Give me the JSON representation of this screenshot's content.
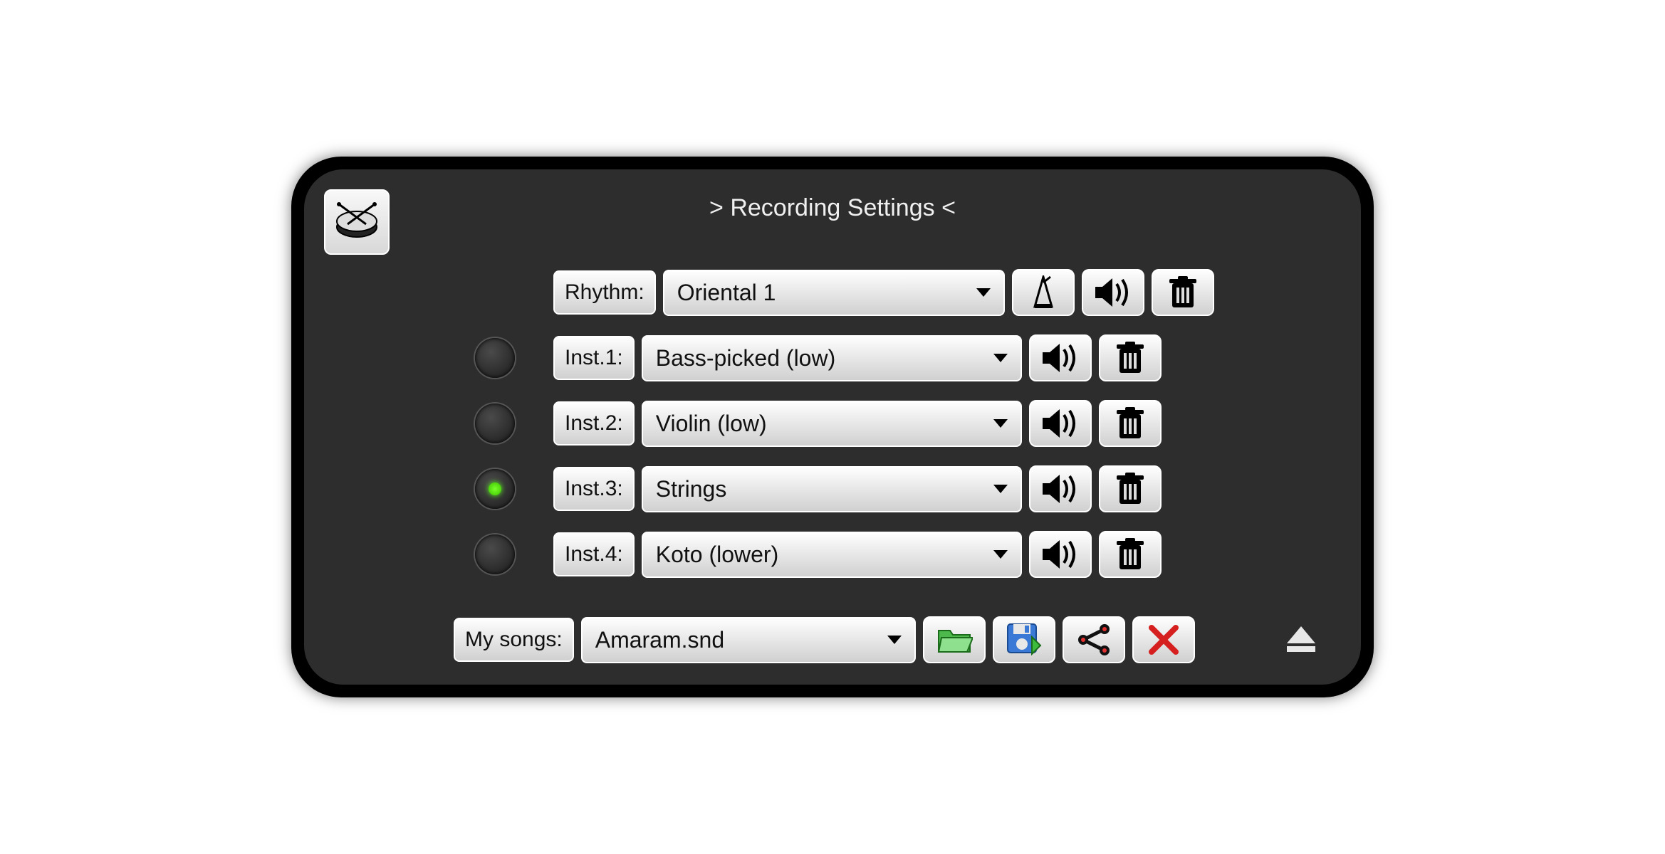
{
  "title": "> Recording Settings <",
  "rhythm": {
    "label": "Rhythm:",
    "value": "Oriental 1"
  },
  "instruments": [
    {
      "label": "Inst.1:",
      "value": "Bass-picked (low)",
      "active": false
    },
    {
      "label": "Inst.2:",
      "value": "Violin (low)",
      "active": false
    },
    {
      "label": "Inst.3:",
      "value": "Strings",
      "active": true
    },
    {
      "label": "Inst.4:",
      "value": "Koto (lower)",
      "active": false
    }
  ],
  "songs": {
    "label": "My songs:",
    "value": "Amaram.snd"
  }
}
